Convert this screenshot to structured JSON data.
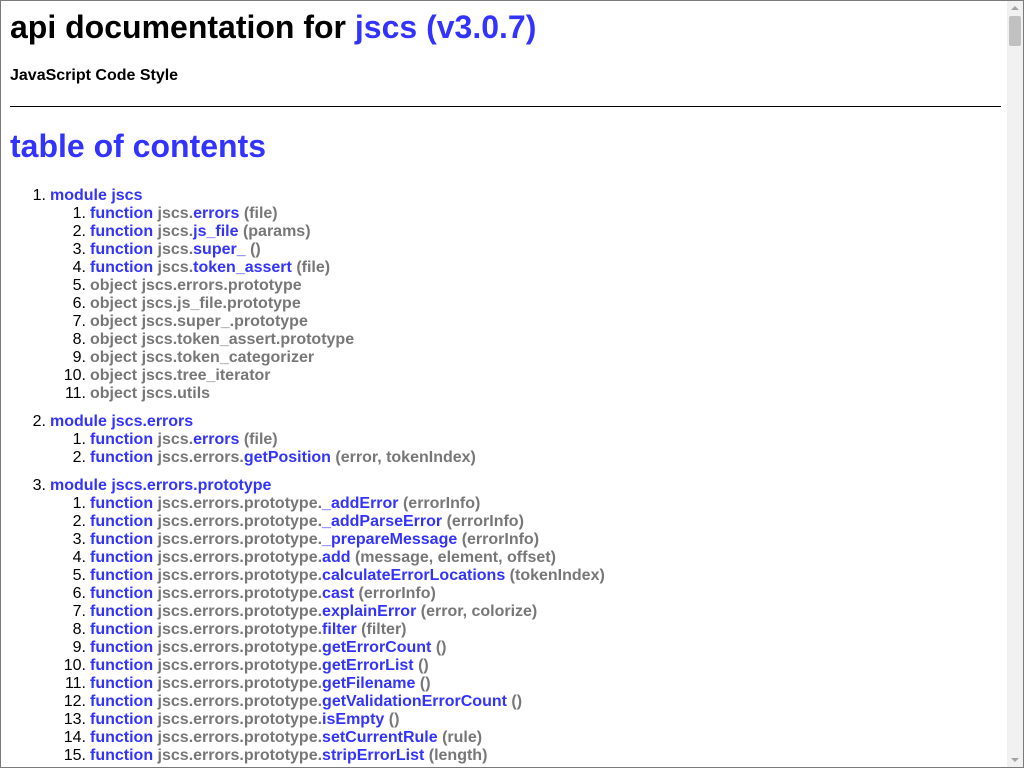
{
  "header": {
    "title_prefix": "api documentation for ",
    "title_link": "jscs (v3.0.7)",
    "subtitle": "JavaScript Code Style"
  },
  "toc": {
    "heading": "table of contents",
    "modules": [
      {
        "num": "1.",
        "label": "module jscs",
        "items": [
          {
            "num": "1.",
            "kind": "function",
            "prefix": "jscs.",
            "name": "errors",
            "args": "(file)"
          },
          {
            "num": "2.",
            "kind": "function",
            "prefix": "jscs.",
            "name": "js_file",
            "args": "(params)"
          },
          {
            "num": "3.",
            "kind": "function",
            "prefix": "jscs.",
            "name": "super_",
            "args": "()"
          },
          {
            "num": "4.",
            "kind": "function",
            "prefix": "jscs.",
            "name": "token_assert",
            "args": "(file)"
          },
          {
            "num": "5.",
            "kind": "object",
            "text": "object jscs.errors.prototype"
          },
          {
            "num": "6.",
            "kind": "object",
            "text": "object jscs.js_file.prototype"
          },
          {
            "num": "7.",
            "kind": "object",
            "text": "object jscs.super_.prototype"
          },
          {
            "num": "8.",
            "kind": "object",
            "text": "object jscs.token_assert.prototype"
          },
          {
            "num": "9.",
            "kind": "object",
            "text": "object jscs.token_categorizer"
          },
          {
            "num": "10.",
            "kind": "object",
            "text": "object jscs.tree_iterator"
          },
          {
            "num": "11.",
            "kind": "object",
            "text": "object jscs.utils"
          }
        ]
      },
      {
        "num": "2.",
        "label": "module jscs.errors",
        "items": [
          {
            "num": "1.",
            "kind": "function",
            "prefix": "jscs.",
            "name": "errors",
            "args": "(file)"
          },
          {
            "num": "2.",
            "kind": "function",
            "prefix": "jscs.errors.",
            "name": "getPosition",
            "args": "(error, tokenIndex)"
          }
        ]
      },
      {
        "num": "3.",
        "label": "module jscs.errors.prototype",
        "items": [
          {
            "num": "1.",
            "kind": "function",
            "prefix": "jscs.errors.prototype.",
            "name": "_addError",
            "args": "(errorInfo)"
          },
          {
            "num": "2.",
            "kind": "function",
            "prefix": "jscs.errors.prototype.",
            "name": "_addParseError",
            "args": "(errorInfo)"
          },
          {
            "num": "3.",
            "kind": "function",
            "prefix": "jscs.errors.prototype.",
            "name": "_prepareMessage",
            "args": "(errorInfo)"
          },
          {
            "num": "4.",
            "kind": "function",
            "prefix": "jscs.errors.prototype.",
            "name": "add",
            "args": "(message, element, offset)"
          },
          {
            "num": "5.",
            "kind": "function",
            "prefix": "jscs.errors.prototype.",
            "name": "calculateErrorLocations",
            "args": "(tokenIndex)"
          },
          {
            "num": "6.",
            "kind": "function",
            "prefix": "jscs.errors.prototype.",
            "name": "cast",
            "args": "(errorInfo)"
          },
          {
            "num": "7.",
            "kind": "function",
            "prefix": "jscs.errors.prototype.",
            "name": "explainError",
            "args": "(error, colorize)"
          },
          {
            "num": "8.",
            "kind": "function",
            "prefix": "jscs.errors.prototype.",
            "name": "filter",
            "args": "(filter)"
          },
          {
            "num": "9.",
            "kind": "function",
            "prefix": "jscs.errors.prototype.",
            "name": "getErrorCount",
            "args": "()"
          },
          {
            "num": "10.",
            "kind": "function",
            "prefix": "jscs.errors.prototype.",
            "name": "getErrorList",
            "args": "()"
          },
          {
            "num": "11.",
            "kind": "function",
            "prefix": "jscs.errors.prototype.",
            "name": "getFilename",
            "args": "()"
          },
          {
            "num": "12.",
            "kind": "function",
            "prefix": "jscs.errors.prototype.",
            "name": "getValidationErrorCount",
            "args": "()"
          },
          {
            "num": "13.",
            "kind": "function",
            "prefix": "jscs.errors.prototype.",
            "name": "isEmpty",
            "args": "()"
          },
          {
            "num": "14.",
            "kind": "function",
            "prefix": "jscs.errors.prototype.",
            "name": "setCurrentRule",
            "args": "(rule)"
          },
          {
            "num": "15.",
            "kind": "function",
            "prefix": "jscs.errors.prototype.",
            "name": "stripErrorList",
            "args": "(length)"
          }
        ]
      }
    ]
  },
  "colors": {
    "link": "#3333ff",
    "muted": "#777777",
    "text": "#000000"
  }
}
